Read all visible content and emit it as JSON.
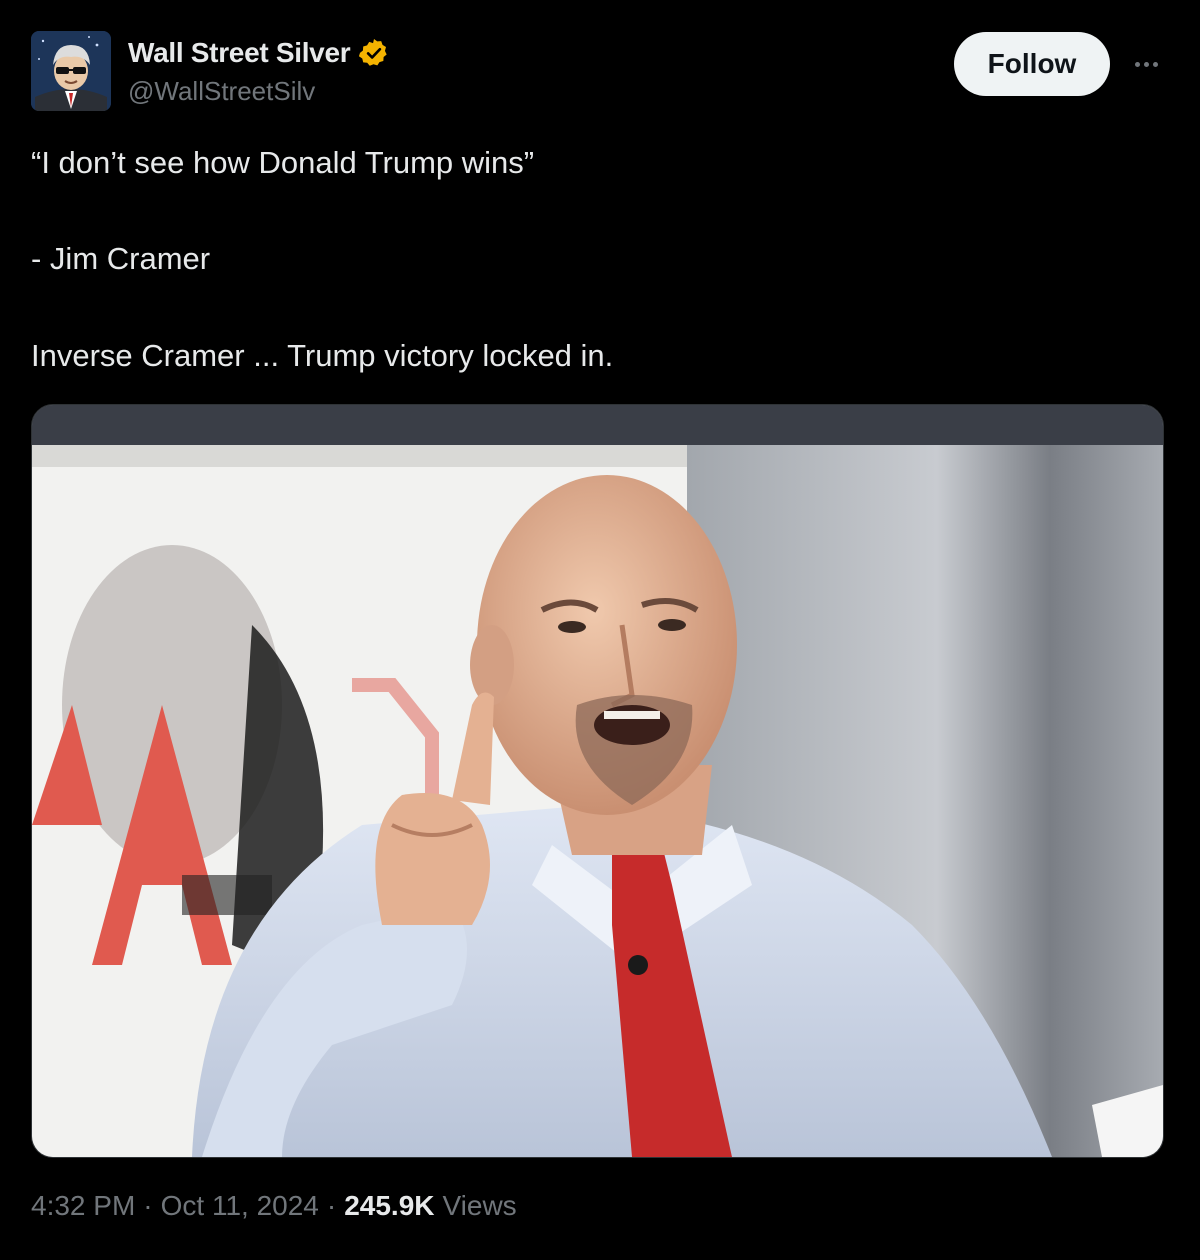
{
  "author": {
    "display_name": "Wall Street Silver",
    "handle": "@WallStreetSilv",
    "verified_color": "#f4b300"
  },
  "actions": {
    "follow_label": "Follow"
  },
  "tweet": {
    "lines": [
      "“I don’t see how Donald Trump wins”",
      "- Jim Cramer",
      "Inverse Cramer ... Trump victory locked in."
    ]
  },
  "meta": {
    "time": "4:32 PM",
    "date": "Oct 11, 2024",
    "views_count": "245.9K",
    "views_label": "Views",
    "separator": "·"
  },
  "icons": {
    "avatar": "wall-street-silver-avatar",
    "verified": "verified-badge-icon",
    "more": "more-options-icon"
  }
}
